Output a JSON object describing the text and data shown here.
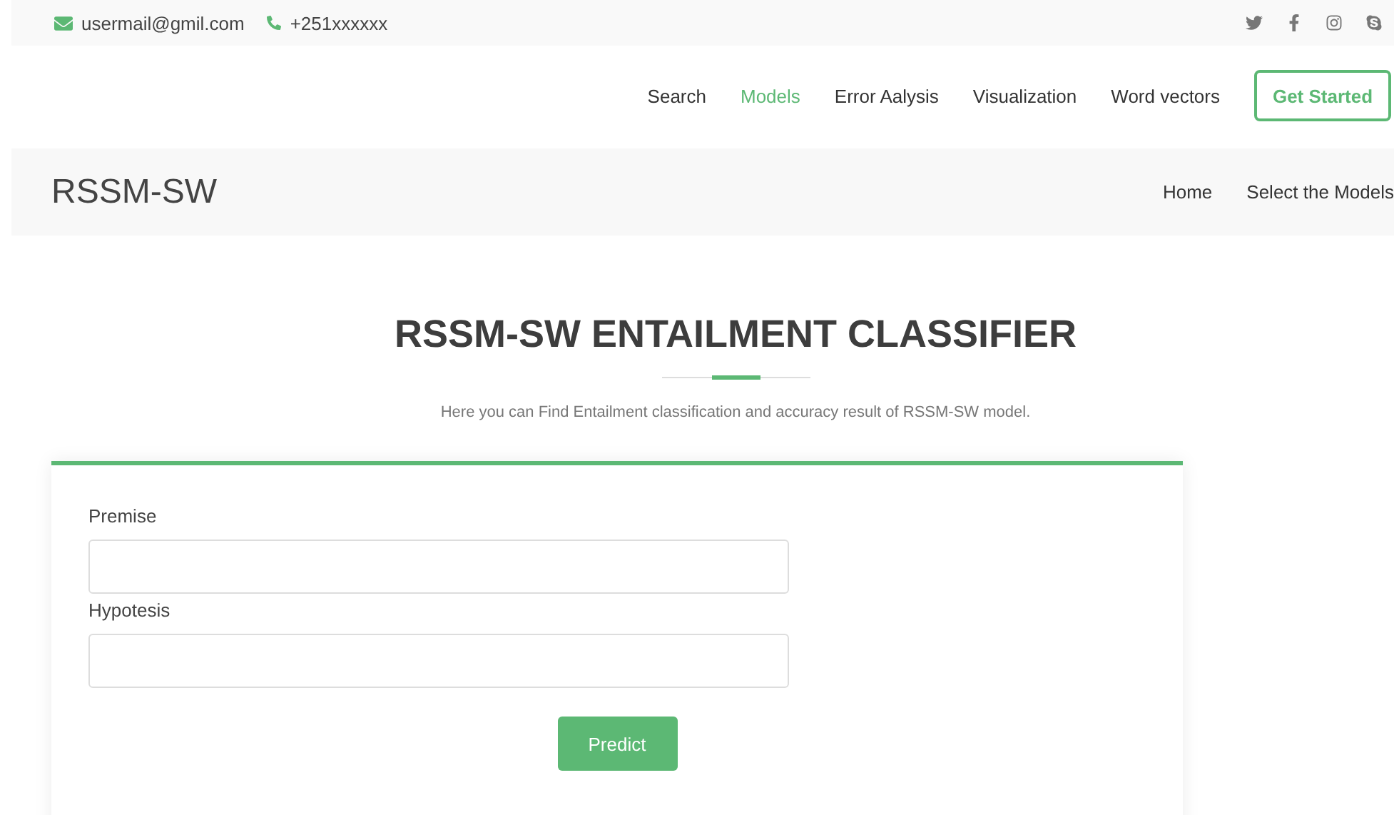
{
  "topbar": {
    "email": "usermail@gmil.com",
    "phone": "+251xxxxxx"
  },
  "nav": {
    "items": [
      {
        "label": "Search",
        "selected": false
      },
      {
        "label": "Models",
        "selected": true
      },
      {
        "label": "Error Aalysis",
        "selected": false
      },
      {
        "label": "Visualization",
        "selected": false
      },
      {
        "label": "Word vectors",
        "selected": false
      }
    ],
    "cta": "Get Started"
  },
  "breadcrumb_bar": {
    "title": "RSSM-SW",
    "links": [
      "Home",
      "Select the Models"
    ]
  },
  "section": {
    "heading": "RSSM-SW ENTAILMENT CLASSIFIER",
    "subtitle": "Here you can Find Entailment classification and accuracy result of RSSM-SW model."
  },
  "form": {
    "fields": [
      {
        "label": "Premise"
      },
      {
        "label": "Hypotesis"
      }
    ],
    "submit": "Predict"
  }
}
